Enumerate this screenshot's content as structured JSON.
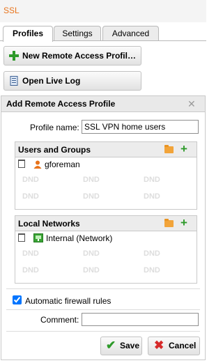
{
  "header": {
    "title": "SSL"
  },
  "tabs": [
    {
      "label": "Profiles",
      "active": true
    },
    {
      "label": "Settings"
    },
    {
      "label": "Advanced"
    }
  ],
  "toolbar": {
    "new_profile_label": "New Remote Access Profil…",
    "open_log_label": "Open Live Log"
  },
  "dialog": {
    "title": "Add Remote Access Profile",
    "profile_name_label": "Profile name:",
    "profile_name_value": "SSL VPN home users",
    "users": {
      "title": "Users and Groups",
      "items": [
        {
          "name": "gforeman",
          "icon": "user-icon"
        }
      ],
      "placeholder": "DND"
    },
    "networks": {
      "title": "Local Networks",
      "items": [
        {
          "name": "Internal (Network)",
          "icon": "network-icon"
        }
      ],
      "placeholder": "DND"
    },
    "auto_firewall_label": "Automatic firewall rules",
    "auto_firewall_checked": true,
    "comment_label": "Comment:",
    "comment_value": "",
    "save_label": "Save",
    "cancel_label": "Cancel"
  },
  "colors": {
    "brand": "#e8731b",
    "add": "#2e9a2a",
    "cancel": "#d62a2a"
  }
}
